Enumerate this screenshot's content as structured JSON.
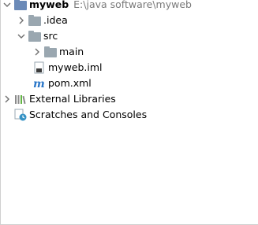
{
  "project": {
    "name": "myweb",
    "path": "E:\\java software\\myweb"
  },
  "items": [
    {
      "label": ".idea"
    },
    {
      "label": "src"
    },
    {
      "label": "main"
    },
    {
      "label": "myweb.iml"
    },
    {
      "label": "pom.xml"
    }
  ],
  "external_libraries": {
    "label": "External Libraries"
  },
  "scratches": {
    "label": "Scratches and Consoles"
  },
  "colors": {
    "folder": "#9aa7b0",
    "project_folder": "#6b8ab8",
    "path_text": "#7a7a7a",
    "maven_icon": "#2a77c9"
  }
}
